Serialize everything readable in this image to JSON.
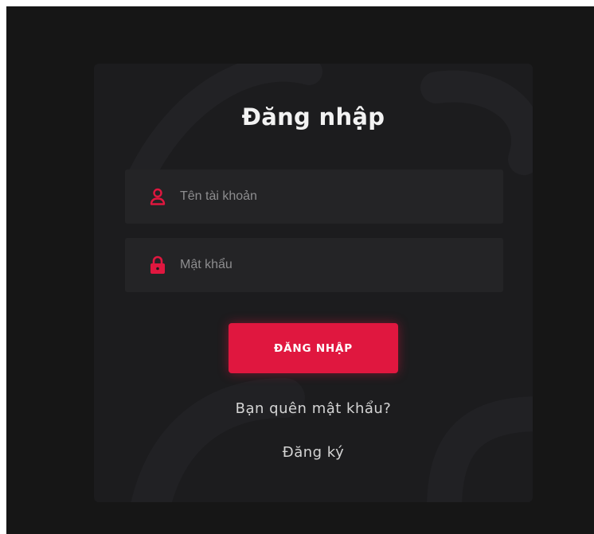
{
  "login": {
    "title": "Đăng nhập",
    "username": {
      "placeholder": "Tên tài khoản",
      "value": "",
      "icon": "user-icon"
    },
    "password": {
      "placeholder": "Mật khẩu",
      "value": "",
      "icon": "lock-icon"
    },
    "submit_label": "ĐĂNG NHẬP",
    "forgot_password_label": "Bạn quên mật khẩu?",
    "register_label": "Đăng ký"
  },
  "colors": {
    "background": "#161616",
    "card": "#1c1c1e",
    "field": "#242426",
    "accent": "#e0173f",
    "text": "#f2f2f2"
  }
}
